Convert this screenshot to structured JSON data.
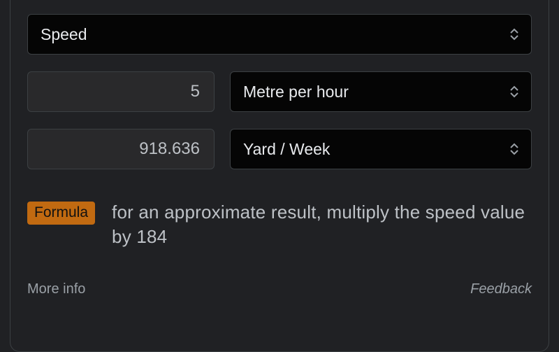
{
  "converter": {
    "category": "Speed",
    "input_value": "5",
    "input_unit": "Metre per hour",
    "output_value": "918.636",
    "output_unit": "Yard / Week"
  },
  "formula": {
    "badge": "Formula",
    "text": "for an approximate result, multiply the speed value by 184"
  },
  "footer": {
    "more_info": "More info",
    "feedback": "Feedback"
  }
}
